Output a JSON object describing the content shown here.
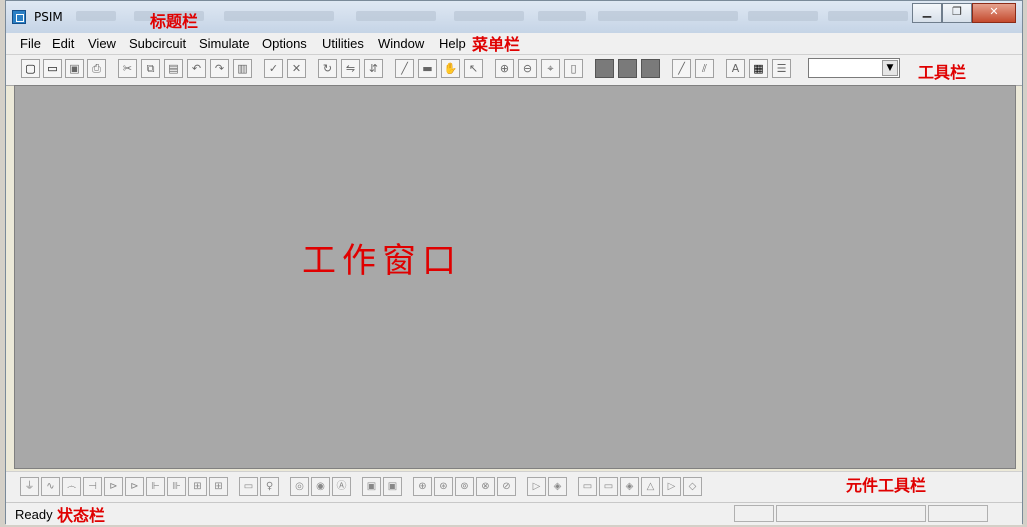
{
  "window": {
    "title": "PSIM"
  },
  "menu": {
    "items": [
      "File",
      "Edit",
      "View",
      "Subcircuit",
      "Simulate",
      "Options",
      "Utilities",
      "Window",
      "Help"
    ]
  },
  "toolbar": {
    "icons": [
      "new-file-icon",
      "open-folder-icon",
      "save-icon",
      "print-icon",
      "cut-icon",
      "copy-icon",
      "paste-icon",
      "undo-icon",
      "redo-icon",
      "clipboard-icon",
      "check-icon",
      "cross-icon",
      "rotate-icon",
      "flip-lr-icon",
      "flip-tb-icon",
      "wire-icon",
      "label-icon",
      "pan-hand-icon",
      "select-arrow-icon",
      "zoom-in-icon",
      "zoom-out-icon",
      "zoom-fit-icon",
      "page-icon",
      "run-icon",
      "pause-icon",
      "stop-icon",
      "probe-icon",
      "probe-multi-icon",
      "text-icon",
      "element-list-icon",
      "library-icon"
    ],
    "combo_value": ""
  },
  "annotations": {
    "title_bar": "标题栏",
    "menu_bar": "菜单栏",
    "toolbar": "工具栏",
    "work_window": "工作窗口",
    "component_toolbar": "元件工具栏",
    "status_bar": "状态栏"
  },
  "component_toolbar": {
    "icons": [
      "ground-icon",
      "resistor-icon",
      "inductor-icon",
      "capacitor-icon",
      "diode-icon",
      "thyristor-icon",
      "igbt-icon",
      "mosfet-icon",
      "switch-icon",
      "transformer-icon",
      "gain-icon",
      "source-icon",
      "dc-source-icon",
      "ac-source-icon",
      "current-source-icon",
      "voltmeter-icon",
      "ammeter-icon",
      "motor-icon",
      "generator-icon",
      "sensor-icon",
      "encoder-icon",
      "load-icon",
      "controller-icon",
      "pi-block-icon",
      "comparator-icon",
      "op-amp-icon",
      "limiter-icon",
      "triangle-wave-icon",
      "logic-gate-icon",
      "flip-flop-icon"
    ]
  },
  "status": {
    "text": "Ready"
  }
}
